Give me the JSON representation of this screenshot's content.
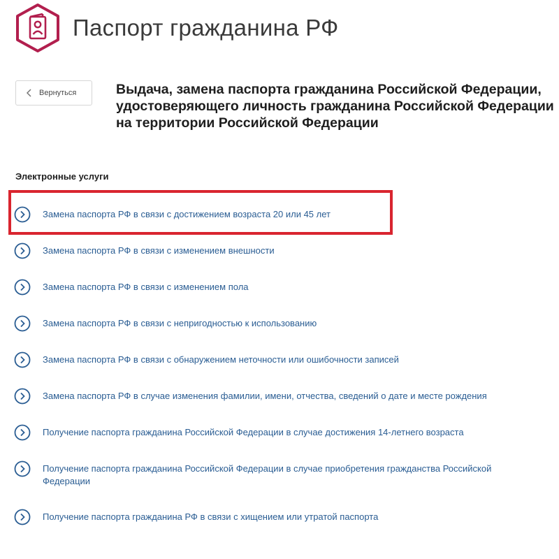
{
  "header": {
    "title": "Паспорт гражданина РФ",
    "logo_icon": "passport-icon",
    "brand_color": "#b21f4e"
  },
  "back_button": {
    "label": "Вернуться",
    "icon": "chevron-left-icon"
  },
  "service": {
    "title_lines": [
      "Выдача, замена паспорта гражданина Российской Федерации,",
      "удостоверяющего личность гражданина Российской Федерации",
      "на территории Российской Федерации"
    ]
  },
  "electronic_services": {
    "heading": "Электронные услуги",
    "icon": "chevron-right-circle-icon",
    "link_color": "#2a5d93",
    "highlight_color": "#d9252f",
    "highlighted_index": 0,
    "items": [
      {
        "label": "Замена паспорта РФ в связи с достижением возраста 20 или 45 лет"
      },
      {
        "label": "Замена паспорта РФ в связи с изменением внешности"
      },
      {
        "label": "Замена паспорта РФ в связи с изменением пола"
      },
      {
        "label": "Замена паспорта РФ в связи с непригодностью к использованию"
      },
      {
        "label": "Замена паспорта РФ в связи с обнаружением неточности или ошибочности записей"
      },
      {
        "label": "Замена паспорта РФ в случае изменения фамилии, имени, отчества, сведений о дате и месте рождения"
      },
      {
        "label": "Получение паспорта гражданина Российской Федерации в случае достижения 14-летнего возраста"
      },
      {
        "label": "Получение паспорта гражданина Российской Федерации в случае приобретения гражданства Российской Федерации"
      },
      {
        "label": "Получение паспорта гражданина РФ в связи с хищением или утратой паспорта"
      }
    ]
  }
}
